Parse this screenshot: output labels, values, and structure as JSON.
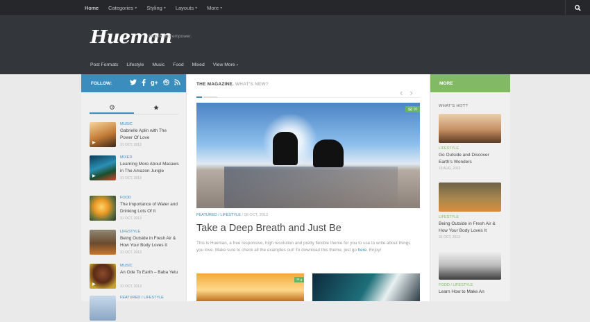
{
  "topnav": {
    "items": [
      {
        "label": "Home",
        "caret": ""
      },
      {
        "label": "Categories",
        "caret": "▾"
      },
      {
        "label": "Styling",
        "caret": "▾"
      },
      {
        "label": "Layouts",
        "caret": "▾"
      },
      {
        "label": "More",
        "caret": "▾"
      }
    ]
  },
  "header": {
    "logo": "Hueman",
    "tagline": "Inspire and empower.",
    "subnav": [
      {
        "label": "Post Formats"
      },
      {
        "label": "Lifestyle"
      },
      {
        "label": "Music"
      },
      {
        "label": "Food"
      },
      {
        "label": "Mixed"
      },
      {
        "label": "View More",
        "caret": "▾"
      }
    ]
  },
  "left": {
    "follow": "FOLLOW:",
    "social_icons": [
      "twitter-icon",
      "facebook-icon",
      "google-plus-icon",
      "dribbble-icon",
      "rss-icon"
    ],
    "posts": [
      {
        "cat": "MUSIC",
        "title": "Gabrielle Aplin with The Power Of Love",
        "date": "31 OCT, 2013",
        "thumb": "#d9a35a",
        "play": "▶"
      },
      {
        "cat": "MIXED",
        "title": "Learning More About Macaws in The Amazon Jungle",
        "date": "31 OCT, 2013",
        "thumb": "#1f6f8f",
        "play": "▶"
      },
      {
        "cat": "FOOD",
        "title": "The Importance of Water and Drinking Lots Of It",
        "date": "31 OCT, 2013",
        "thumb": "#e69a2a",
        "play": ""
      },
      {
        "cat": "LIFESTYLE",
        "title": "Being Outside in Fresh Air & How Your Body Loves It",
        "date": "31 OCT, 2013",
        "thumb": "#6b4a30",
        "play": ""
      },
      {
        "cat": "MUSIC",
        "title": "An Ode To Earth – Baba Yetu",
        "date": "31 OCT, 2013",
        "thumb": "#7a3c25",
        "play": "▶"
      },
      {
        "cat": "FEATURED / LIFESTYLE",
        "title": "",
        "date": "",
        "thumb": "#9fb7d3",
        "play": ""
      }
    ]
  },
  "main": {
    "head_a": "THE MAGAZINE.",
    "head_b": "WHAT'S NEW?",
    "badge": "10",
    "cat_a": "FEATURED",
    "cat_b": "LIFESTYLE",
    "date": "08 OCT, 2013",
    "title": "Take a Deep Breath and Just Be",
    "excerpt": "This is Hueman, a free responsive, high resolution and pretty flexible theme for you to use to write about things you love. Make sure to check all the examples out! To download this theme, just go ",
    "excerpt_link": "here",
    "excerpt_end": ". Enjoy!",
    "thumb_badge": "3"
  },
  "right": {
    "more": "MORE",
    "hot": "WHAT'S HOT?",
    "posts": [
      {
        "cat": "LIFESTYLE",
        "title": "Go Outside and Discover Earth's Wonders",
        "date": "15 AUG, 2013",
        "img": "linear-gradient(180deg,#e9c49d,#b47a54 60%,#5b3a23)"
      },
      {
        "cat": "LIFESTYLE",
        "title": "Being Outside in Fresh Air & How Your Body Loves It",
        "date": "31 OCT, 2013",
        "img": "linear-gradient(180deg,#6d6247,#a8884e 55%,#d98d3d)"
      },
      {
        "cat": "FOOD / LIFESTYLE",
        "title": "Learn How to Make An",
        "date": "",
        "img": "linear-gradient(180deg,#f3f3f3,#bdbdbd 50%,#3c3c3c)"
      }
    ]
  }
}
